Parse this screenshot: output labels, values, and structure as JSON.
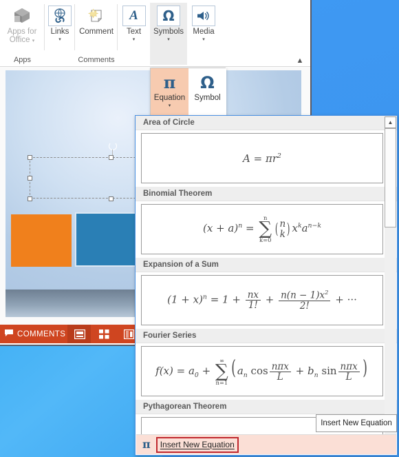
{
  "ribbon": {
    "groups": [
      {
        "name": "Apps",
        "buttons": [
          {
            "label": "Apps for",
            "label2": "Office",
            "icon": "apps-cube-icon",
            "disabled": true,
            "caret": "▾"
          }
        ]
      },
      {
        "name": "",
        "buttons": [
          {
            "label": "Links",
            "icon": "link-globe-icon",
            "disabled": false,
            "caret": "▾"
          }
        ]
      },
      {
        "name": "Comments",
        "buttons": [
          {
            "label": "Comment",
            "icon": "comment-page-icon",
            "disabled": false,
            "caret": ""
          }
        ]
      },
      {
        "name": "",
        "buttons": [
          {
            "label": "Text",
            "icon": "text-a-icon",
            "glyph": "A",
            "disabled": false,
            "caret": "▾"
          },
          {
            "label": "Symbols",
            "icon": "symbols-omega-icon",
            "glyph": "Ω",
            "disabled": false,
            "caret": "▾",
            "highlighted": true
          },
          {
            "label": "Media",
            "icon": "media-speaker-icon",
            "disabled": false,
            "caret": "▾"
          }
        ]
      }
    ],
    "collapse_icon": "collapse-ribbon-chevron-icon"
  },
  "symbols_dropdown": {
    "equation": {
      "label": "Equation",
      "glyph": "π",
      "caret": "▾",
      "selected": true
    },
    "symbol": {
      "label": "Symbol",
      "glyph": "Ω",
      "selected": false
    }
  },
  "slide": {
    "placeholder_selected": true,
    "shapes": [
      {
        "name": "orange-rectangle",
        "color": "#f0801c"
      },
      {
        "name": "blue-rectangle",
        "color": "#2a7fb5"
      }
    ]
  },
  "status_bar": {
    "comments_label": "COMMENTS",
    "comments_icon": "comment-bubble-icon",
    "views": [
      {
        "name": "normal-view-button",
        "icon": "normal-view-icon",
        "active": true
      },
      {
        "name": "slide-sorter-button",
        "icon": "slide-sorter-icon",
        "active": false
      },
      {
        "name": "reading-view-button",
        "icon": "reading-view-icon",
        "active": false
      }
    ],
    "accent_color": "#cf4520"
  },
  "gallery": {
    "items": [
      {
        "category": "Area of Circle",
        "equation_text": "A = πr²"
      },
      {
        "category": "Binomial Theorem",
        "equation_text": "(x + a)ⁿ = ∑(k=0..n) (n choose k) xᵏ aⁿ⁻ᵏ"
      },
      {
        "category": "Expansion of a Sum",
        "equation_text": "(1 + x)ⁿ = 1 + nx/1! + n(n−1)x²/2! + ⋯"
      },
      {
        "category": "Fourier Series",
        "equation_text": "f(x) = a₀ + ∑(n=1..∞) (aₙ cos nπx/L + bₙ sin nπx/L)"
      },
      {
        "category": "Pythagorean Theorem",
        "equation_text": ""
      }
    ],
    "scrollbar": {
      "up_arrow": "▲",
      "position": "top"
    },
    "insert_new": {
      "label": "Insert New Equation",
      "icon": "pi-icon",
      "highlighted": true,
      "highlight_color": "#c0272d"
    }
  },
  "tooltip": {
    "text": "Insert New Equation"
  }
}
